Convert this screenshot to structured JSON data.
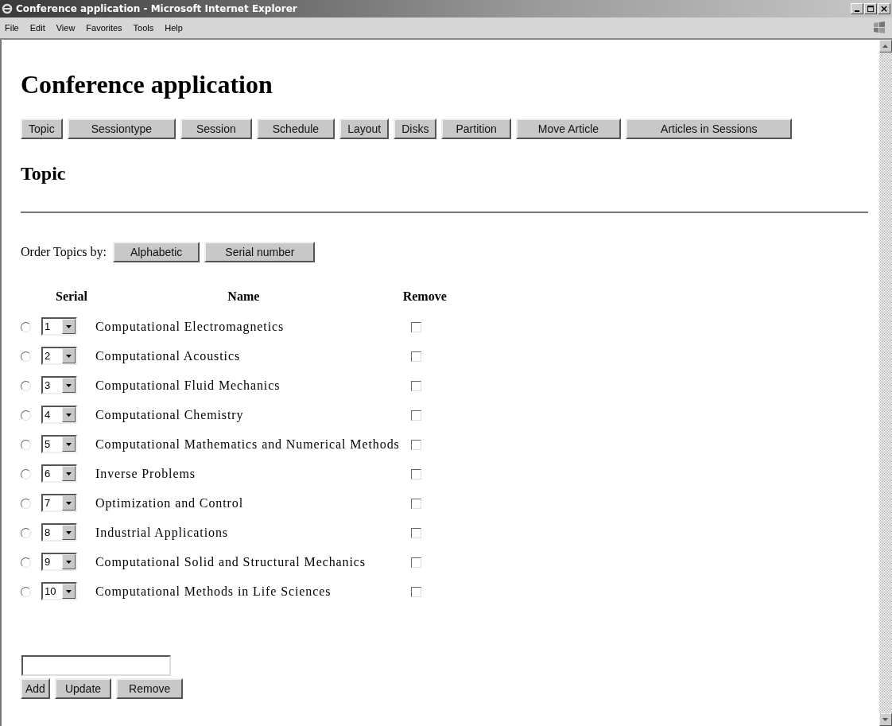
{
  "window": {
    "title": "Conference application - Microsoft Internet Explorer"
  },
  "menu": [
    "File",
    "Edit",
    "View",
    "Favorites",
    "Tools",
    "Help"
  ],
  "page": {
    "heading": "Conference application",
    "nav": [
      "Topic",
      "Sessiontype",
      "Session",
      "Schedule",
      "Layout",
      "Disks",
      "Partition",
      "Move Article",
      "Articles in Sessions"
    ],
    "section": "Topic",
    "order": {
      "label": "Order Topics by:",
      "buttons": [
        "Alphabetic",
        "Serial number"
      ]
    },
    "table": {
      "columns": [
        "Serial",
        "Name",
        "Remove"
      ],
      "rows": [
        {
          "selected": false,
          "serial": "1",
          "name": "Computational Electromagnetics",
          "checked": false
        },
        {
          "selected": false,
          "serial": "2",
          "name": "Computational Acoustics",
          "checked": false
        },
        {
          "selected": false,
          "serial": "3",
          "name": "Computational Fluid Mechanics",
          "checked": false
        },
        {
          "selected": false,
          "serial": "4",
          "name": "Computational Chemistry",
          "checked": false
        },
        {
          "selected": false,
          "serial": "5",
          "name": "Computational Mathematics and Numerical Methods",
          "checked": false
        },
        {
          "selected": false,
          "serial": "6",
          "name": "Inverse Problems",
          "checked": false
        },
        {
          "selected": false,
          "serial": "7",
          "name": "Optimization and Control",
          "checked": false
        },
        {
          "selected": false,
          "serial": "8",
          "name": "Industrial Applications",
          "checked": false
        },
        {
          "selected": false,
          "serial": "9",
          "name": "Computational Solid and Structural Mechanics",
          "checked": false
        },
        {
          "selected": false,
          "serial": "10",
          "name": "Computational Methods in Life Sciences",
          "checked": false
        }
      ]
    },
    "actions": [
      "Add",
      "Update",
      "Remove"
    ]
  }
}
